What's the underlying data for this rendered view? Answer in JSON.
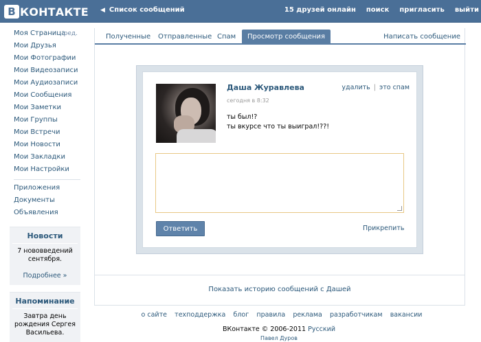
{
  "header": {
    "logo_letter": "В",
    "logo_text": "КОНТАКТЕ",
    "back_label": "Список сообщений",
    "nav": [
      "15 друзей онлайн",
      "поиск",
      "пригласить",
      "выйти"
    ]
  },
  "sidebar": {
    "items": [
      {
        "label": "Моя Страница",
        "edit": "ред."
      },
      {
        "label": "Мои Друзья"
      },
      {
        "label": "Мои Фотографии"
      },
      {
        "label": "Мои Видеозаписи"
      },
      {
        "label": "Мои Аудиозаписи"
      },
      {
        "label": "Мои Сообщения"
      },
      {
        "label": "Мои Заметки"
      },
      {
        "label": "Мои Группы"
      },
      {
        "label": "Мои Встречи"
      },
      {
        "label": "Мои Новости"
      },
      {
        "label": "Мои Закладки"
      },
      {
        "label": "Мои Настройки"
      }
    ],
    "extra_items": [
      "Приложения",
      "Документы",
      "Объявления"
    ],
    "news_box": {
      "title": "Новости",
      "text": "7 нововведений сентября.",
      "more": "Подробнее »"
    },
    "reminder_box": {
      "title": "Напоминание",
      "text": "Завтра день рождения Сергея Васильева."
    }
  },
  "tabs": {
    "items": [
      "Полученные",
      "Отправленные",
      "Спам",
      "Просмотр сообщения"
    ],
    "active_index": 3,
    "write": "Написать сообщение"
  },
  "message": {
    "sender": "Даша Журавлева",
    "date": "сегодня в 8:32",
    "delete": "удалить",
    "separator": "|",
    "spam": "это спам",
    "lines": [
      "ты был!?",
      "ты вкурсе что ты выиграл!??!"
    ],
    "reply_value": "",
    "send_label": "Ответить",
    "attach_label": "Прикрепить"
  },
  "history_link": "Показать историю сообщений с Дашей",
  "footer": {
    "links": [
      "о сайте",
      "техподдержка",
      "блог",
      "правила",
      "реклама",
      "разработчикам",
      "вакансии"
    ],
    "copyright": "ВКонтакте © 2006-2011",
    "language": "Русский",
    "author": "Павел Дуров"
  },
  "colors": {
    "header_bg": "#4A6F97",
    "link": "#2B587A",
    "active_tab": "#597DA3",
    "button": "#5F83AA",
    "reply_border": "#E8C784"
  }
}
